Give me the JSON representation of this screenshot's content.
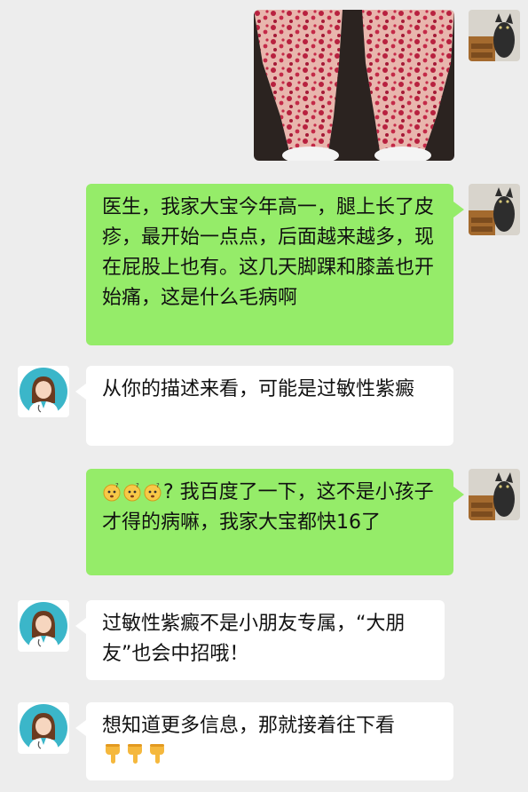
{
  "chat": {
    "messages": [
      {
        "sender": "user",
        "type": "image",
        "image_desc": "rash-legs-photo"
      },
      {
        "sender": "user",
        "type": "text",
        "text": "医生，我家大宝今年高一，腿上长了皮疹，最开始一点点，后面越来越多，现在屁股上也有。这几天脚踝和膝盖也开始痛，这是什么毛病啊"
      },
      {
        "sender": "doctor",
        "type": "text",
        "text": "从你的描述来看，可能是过敏性紫癜"
      },
      {
        "sender": "user",
        "type": "text",
        "emoji_prefix": [
          "thinking-face-icon",
          "thinking-face-icon",
          "thinking-face-icon"
        ],
        "text": "? 我百度了一下，这不是小孩子才得的病嘛，我家大宝都快16了"
      },
      {
        "sender": "doctor",
        "type": "text",
        "text": "过敏性紫癜不是小朋友专属，“大朋友”也会中招哦！"
      },
      {
        "sender": "doctor",
        "type": "text",
        "text": "想知道更多信息，那就接着往下看",
        "emoji_suffix": [
          "pointing-down-icon",
          "pointing-down-icon",
          "pointing-down-icon"
        ]
      }
    ]
  },
  "colors": {
    "background": "#ededed",
    "user_bubble": "#95ec69",
    "doctor_bubble": "#ffffff",
    "doctor_avatar_circle": "#3bb6c9"
  },
  "avatars": {
    "user": "cat-avatar-icon",
    "doctor": "female-doctor-avatar-icon"
  }
}
